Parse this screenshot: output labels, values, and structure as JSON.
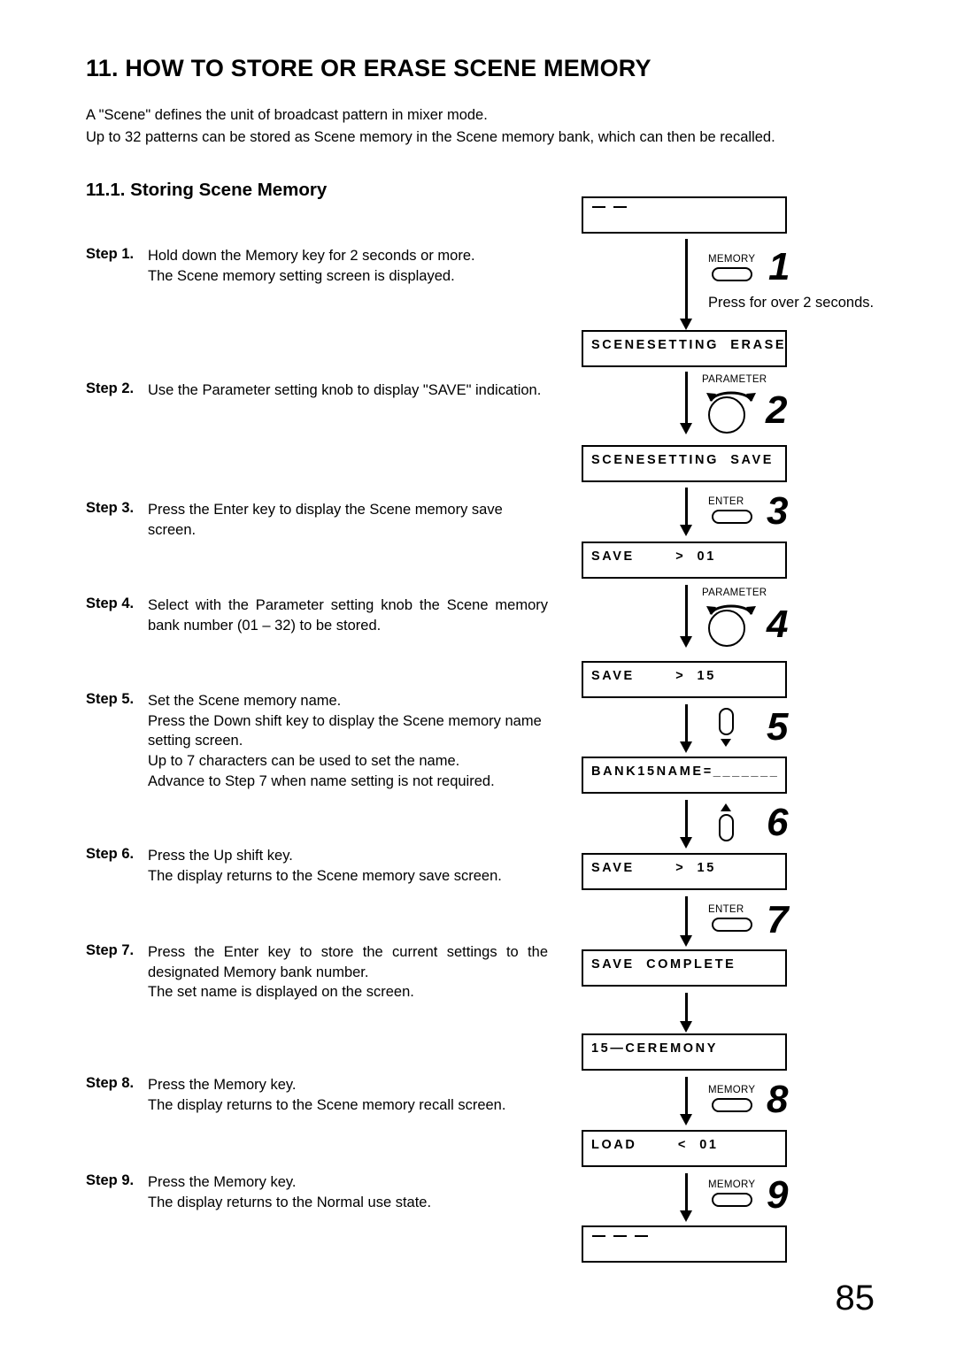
{
  "document": {
    "title": "11. HOW TO STORE OR ERASE SCENE MEMORY",
    "intro_line_1": "A \"Scene\" defines the unit of broadcast pattern in mixer mode.",
    "intro_line_2": "Up to 32 patterns can be stored as Scene memory in the Scene memory bank, which can then be recalled.",
    "section_title": "11.1. Storing Scene Memory",
    "page_number": "85"
  },
  "steps": [
    {
      "label": "Step 1.",
      "lines": [
        "Hold down the Memory key for 2 seconds or more.",
        "The Scene memory setting screen is displayed."
      ]
    },
    {
      "label": "Step 2.",
      "lines": [
        "Use the Parameter setting knob to display \"SAVE\" indication."
      ]
    },
    {
      "label": "Step 3.",
      "lines": [
        "Press the Enter key to display the Scene memory save screen."
      ]
    },
    {
      "label": "Step 4.",
      "lines": [
        "Select with the Parameter setting knob the Scene memory bank number (01 – 32) to be stored."
      ]
    },
    {
      "label": "Step 5.",
      "lines": [
        "Set the Scene memory name.",
        "Press the Down shift key to display the Scene memory name setting screen.",
        "Up to 7 characters can be used to set the name.",
        "Advance to Step 7 when name setting is not required."
      ]
    },
    {
      "label": "Step 6.",
      "lines": [
        "Press the Up shift key.",
        "The display returns to the Scene memory save screen."
      ]
    },
    {
      "label": "Step 7.",
      "lines": [
        "Press the Enter key to store the current settings to the designated Memory bank number.",
        "The set name is displayed on the screen."
      ]
    },
    {
      "label": "Step 8.",
      "lines": [
        "Press the Memory key.",
        "The display returns to the Scene memory recall screen."
      ]
    },
    {
      "label": "Step 9.",
      "lines": [
        "Press the Memory key.",
        "The display returns to the Normal use state."
      ]
    }
  ],
  "diagram": {
    "displays": [
      {
        "id": "display-initial-top",
        "text": "",
        "dashes": 2
      },
      {
        "id": "display-scenesetting-erase",
        "text": "SCENESETTING  ERASE",
        "dashes": 0
      },
      {
        "id": "display-scenesetting-save",
        "text": "SCENESETTING  SAVE",
        "dashes": 0
      },
      {
        "id": "display-save-01",
        "text": "SAVE       >  01",
        "dashes": 0
      },
      {
        "id": "display-save-15",
        "text": "SAVE       >  15",
        "dashes": 0
      },
      {
        "id": "display-bank15-name",
        "text": "BANK15NAME=_______",
        "dashes": 0
      },
      {
        "id": "display-save-15-again",
        "text": "SAVE       >  15",
        "dashes": 0
      },
      {
        "id": "display-save-complete",
        "text": "SAVE  COMPLETE",
        "dashes": 0
      },
      {
        "id": "display-15-ceremony",
        "text": "15—CEREMONY",
        "dashes": 0
      },
      {
        "id": "display-load-01",
        "text": "LOAD       <  01",
        "dashes": 0
      },
      {
        "id": "display-initial-bottom",
        "text": "",
        "dashes": 3
      }
    ],
    "controls": [
      {
        "id": "control-1",
        "type": "key",
        "label": "MEMORY",
        "number": "1"
      },
      {
        "id": "control-2",
        "type": "knob",
        "label": "PARAMETER",
        "number": "2"
      },
      {
        "id": "control-3",
        "type": "key",
        "label": "ENTER",
        "number": "3"
      },
      {
        "id": "control-4",
        "type": "knob",
        "label": "PARAMETER",
        "number": "4"
      },
      {
        "id": "control-5",
        "type": "shift-down",
        "label": "",
        "number": "5"
      },
      {
        "id": "control-6",
        "type": "shift-up",
        "label": "",
        "number": "6"
      },
      {
        "id": "control-7",
        "type": "key",
        "label": "ENTER",
        "number": "7"
      },
      {
        "id": "control-8",
        "type": "key",
        "label": "MEMORY",
        "number": "8"
      },
      {
        "id": "control-9",
        "type": "key",
        "label": "MEMORY",
        "number": "9"
      }
    ],
    "caption_press_2_seconds": "Press for over 2 seconds."
  }
}
